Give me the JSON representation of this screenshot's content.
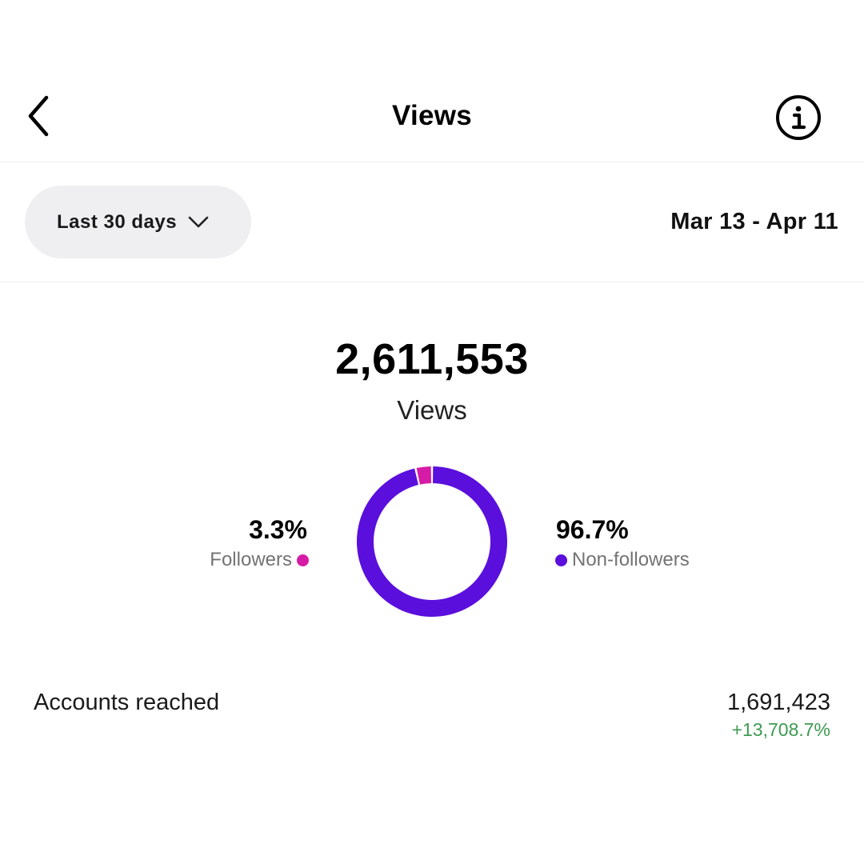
{
  "header": {
    "title": "Views",
    "back_icon": "chevron-left-icon",
    "info_icon": "info-icon"
  },
  "filter": {
    "range_label": "Last 30 days",
    "dropdown_icon": "chevron-down-icon",
    "date_range": "Mar 13 - Apr 11"
  },
  "summary": {
    "total": "2,611,553",
    "label": "Views"
  },
  "breakdown": {
    "followers": {
      "percent": "3.3%",
      "label": "Followers",
      "value": 3.3,
      "color": "#d61ba7"
    },
    "non_followers": {
      "percent": "96.7%",
      "label": "Non-followers",
      "value": 96.7,
      "color": "#5a0fdc"
    }
  },
  "reach": {
    "label": "Accounts reached",
    "value": "1,691,423",
    "change": "+13,708.7%",
    "change_color": "#3d9a52"
  }
}
